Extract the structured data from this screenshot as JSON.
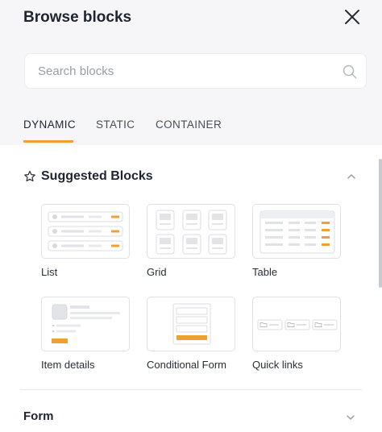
{
  "header": {
    "title": "Browse blocks"
  },
  "search": {
    "placeholder": "Search blocks",
    "value": ""
  },
  "tabs": [
    {
      "label": "DYNAMIC",
      "active": true
    },
    {
      "label": "STATIC",
      "active": false
    },
    {
      "label": "CONTAINER",
      "active": false
    }
  ],
  "sections": {
    "suggested": {
      "title": "Suggested Blocks",
      "expanded": true,
      "blocks": [
        {
          "label": "List"
        },
        {
          "label": "Grid"
        },
        {
          "label": "Table"
        },
        {
          "label": "Item details"
        },
        {
          "label": "Conditional Form"
        },
        {
          "label": "Quick links"
        }
      ]
    },
    "form": {
      "title": "Form",
      "expanded": false
    }
  },
  "colors": {
    "accent": "#f0a030",
    "header_bg": "#f6f6f8",
    "placeholder_block": "#e6e7ea"
  },
  "icons": {
    "close": "close-icon",
    "search": "search-icon",
    "star": "star-icon",
    "collapse": "chevron-up-icon",
    "expand": "chevron-down-icon"
  }
}
